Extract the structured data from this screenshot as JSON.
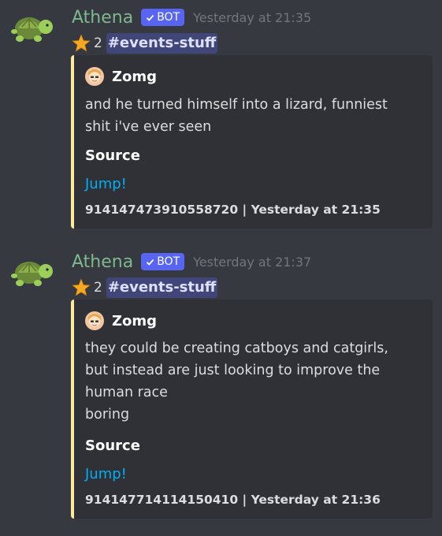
{
  "colors": {
    "background": "#36393f",
    "embed_background": "#2f3136",
    "embed_accent": "#fde9a0",
    "author_name": "#7fb78e",
    "bot_tag": "#5865f2",
    "link": "#00aff4",
    "timestamp": "#72767d"
  },
  "messages": [
    {
      "avatar_icon": "turtle-icon",
      "author": "Athena",
      "bot_label": "BOT",
      "timestamp": "Yesterday at 21:35",
      "star_icon": "star-icon",
      "star_count": "2",
      "channel": "#events-stuff",
      "embed": {
        "author_icon": "user-avatar-icon",
        "author_name": "Zomg",
        "description_lines": [
          "and he turned himself into a lizard, funniest",
          "shit i've ever seen"
        ],
        "field_name": "Source",
        "field_link": "Jump!",
        "footer": "914147473910558720 | Yesterday at 21:35"
      }
    },
    {
      "avatar_icon": "turtle-icon",
      "author": "Athena",
      "bot_label": "BOT",
      "timestamp": "Yesterday at 21:37",
      "star_icon": "star-icon",
      "star_count": "2",
      "channel": "#events-stuff",
      "embed": {
        "author_icon": "user-avatar-icon",
        "author_name": "Zomg",
        "description_lines": [
          "they could be creating catboys and catgirls,",
          "but instead are just looking to improve the",
          "human race",
          "boring"
        ],
        "field_name": "Source",
        "field_link": "Jump!",
        "footer": "914147714114150410 | Yesterday at 21:36"
      }
    }
  ]
}
